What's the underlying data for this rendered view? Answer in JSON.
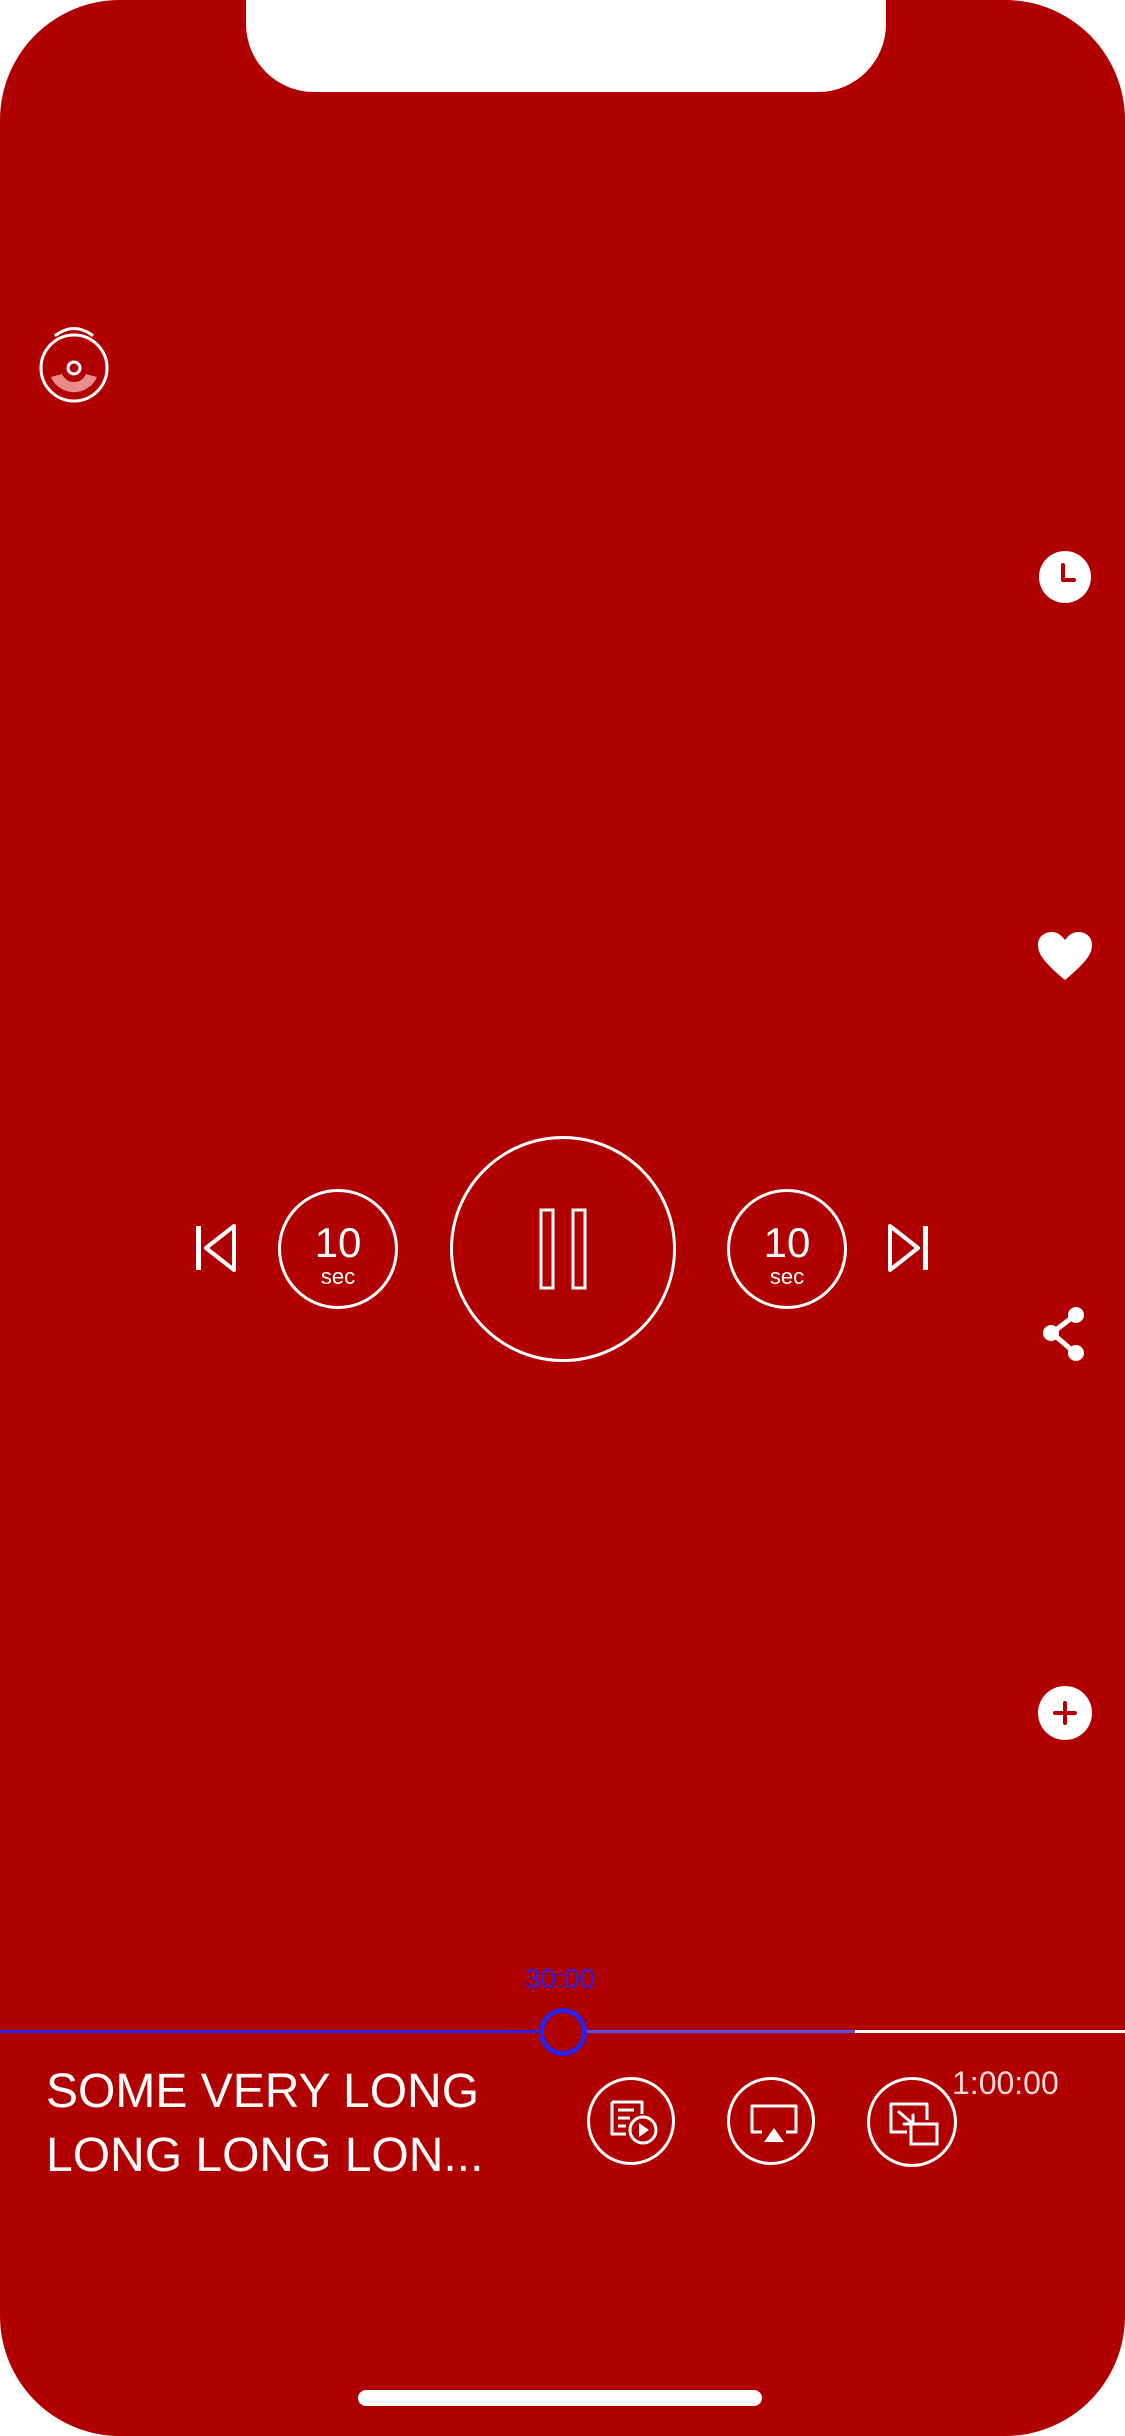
{
  "colors": {
    "background": "#B00000",
    "foreground": "#FFFFFF",
    "progress_accent": "#2C22E8",
    "buffered": "#5A50E6"
  },
  "top": {
    "cast_icon": "disc-cast-icon"
  },
  "side_actions": [
    {
      "name": "schedule",
      "icon": "clock-icon"
    },
    {
      "name": "favorite",
      "icon": "heart-icon"
    },
    {
      "name": "share",
      "icon": "share-icon"
    },
    {
      "name": "add",
      "icon": "plus-icon"
    }
  ],
  "controls": {
    "previous_icon": "skip-previous-icon",
    "rewind": {
      "amount": "10",
      "unit": "sec",
      "icon": "rewind-10-icon"
    },
    "play_pause_icon": "pause-icon",
    "forward": {
      "amount": "10",
      "unit": "sec",
      "icon": "forward-10-icon"
    },
    "next_icon": "skip-next-icon"
  },
  "progress": {
    "current_time": "30:00",
    "total_time": "1:00:00",
    "played_fraction": 0.5,
    "buffered_fraction": 0.76
  },
  "track": {
    "title": "SOME VERY LONG\nLONG LONG LON..."
  },
  "bottom_actions": [
    {
      "name": "playlist",
      "icon": "playlist-play-icon"
    },
    {
      "name": "airplay",
      "icon": "airplay-icon"
    },
    {
      "name": "picture-in-picture",
      "icon": "picture-in-picture-icon"
    }
  ]
}
